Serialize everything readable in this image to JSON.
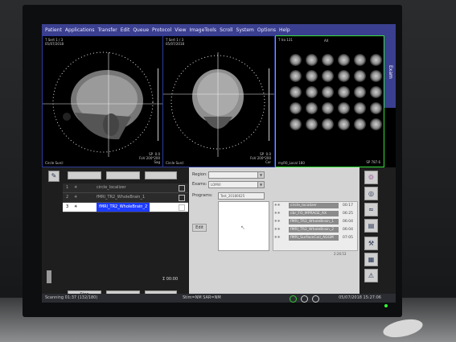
{
  "menu": [
    "Patient",
    "Applications",
    "Transfer",
    "Edit",
    "Queue",
    "Protocol",
    "View",
    "ImageTools",
    "Scroll",
    "System",
    "Options",
    "Help"
  ],
  "viewports": {
    "sagittal": {
      "header": "T Sert 1 / 3\n05/07/2018",
      "footer": "Circle Surcl",
      "info": "SP  0.0\nFoV 200*200\nSag",
      "scale": "10cm"
    },
    "coronal": {
      "header": "T Sert 1 / 3\n05/07/2018",
      "footer": "Circle Surcl",
      "info": "SP  0.0\nFoV 200*200\nCor",
      "scale": "10cm"
    },
    "axial": {
      "header": "T Ira 131",
      "label": "AX",
      "footer": "myR0_Local 180",
      "info": "SP 787.6"
    }
  },
  "exam_tab": "Exam",
  "queue": {
    "buttons_top": [
      "",
      "",
      ""
    ],
    "rows": [
      {
        "num": "1",
        "name": "circle_localizer",
        "selected": false
      },
      {
        "num": "2",
        "name": "fMRI_TR2_WholeBrain_1",
        "selected": false
      },
      {
        "num": "3",
        "name": "fMRI_TR2_WholeBrain_2",
        "selected": true
      }
    ],
    "elapsed": "Σ 00:00",
    "bottom_buttons": [
      "Stop",
      "",
      ""
    ]
  },
  "panel": {
    "region_label": "Region:",
    "exams_label": "Exams:",
    "exams_value": "LOMVI",
    "programs_label": "Programs:",
    "program_name": "Test_20180625",
    "side_button": "Edit",
    "protocols": [
      {
        "name": "circle_localizer",
        "time": "00:17"
      },
      {
        "name": "cbr_FO_MPRAGE_AX",
        "time": "06:25"
      },
      {
        "name": "fMRI_TR2_WholeBrain_1",
        "time": "06:04"
      },
      {
        "name": "fMRI_TR2_WholeBrain_2",
        "time": "06:04"
      },
      {
        "name": "fMRI_SurfaceCoil_AGGM",
        "time": "07:05"
      }
    ],
    "total": "2:26:53",
    "tab_label": "Program"
  },
  "status": {
    "left": "Scanning 01:37 (132/180)",
    "center": "Stim=NM  SAR=NM",
    "right": "05/07/2018 15:27:06"
  }
}
